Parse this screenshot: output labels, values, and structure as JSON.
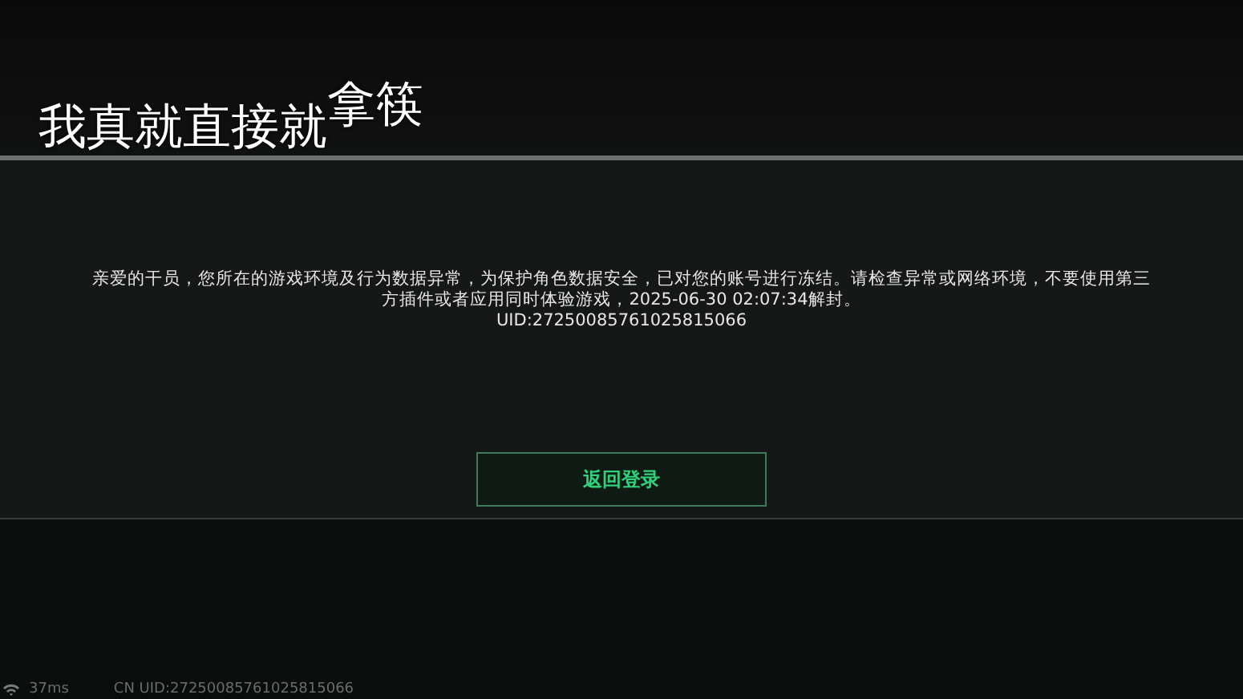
{
  "caption": "我真就直接就$^{拿筷}$",
  "dialog": {
    "message": "亲爱的干员，您所在的游戏环境及行为数据异常，为保护角色数据安全，已对您的账号进行冻结。请检查异常或网络环境，不要使用第三方插件或者应用同时体验游戏，2025-06-30 02:07:34解封。",
    "uid": "UID:27250085761025815066",
    "button": "返回登录"
  },
  "status_bar": {
    "ping": "37ms",
    "uid": "CN UID:27250085761025815066"
  }
}
